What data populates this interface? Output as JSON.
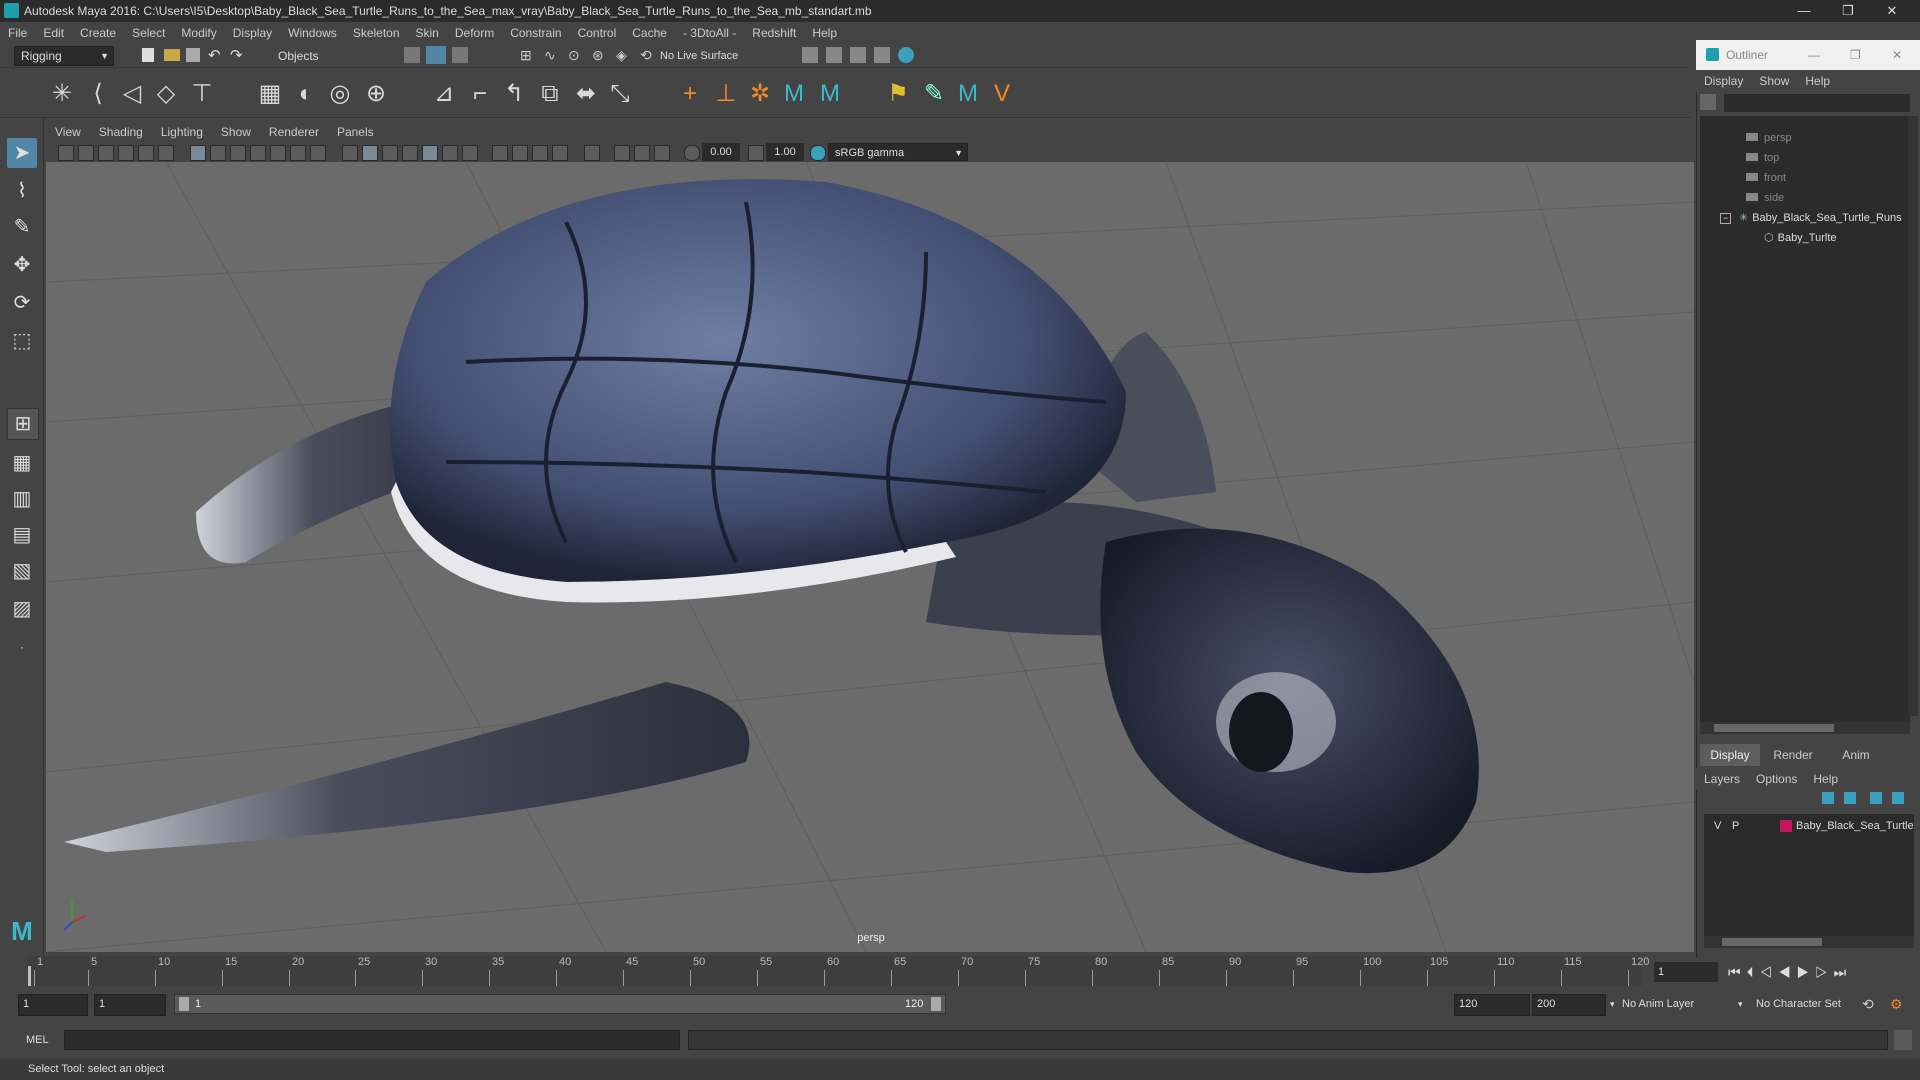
{
  "window": {
    "title": "Autodesk Maya 2016: C:\\Users\\I5\\Desktop\\Baby_Black_Sea_Turtle_Runs_to_the_Sea_max_vray\\Baby_Black_Sea_Turtle_Runs_to_the_Sea_mb_standart.mb",
    "minimize": "—",
    "restore": "❐",
    "close": "✕"
  },
  "menu": [
    "File",
    "Edit",
    "Create",
    "Select",
    "Modify",
    "Display",
    "Windows",
    "Skeleton",
    "Skin",
    "Deform",
    "Constrain",
    "Control",
    "Cache",
    "- 3DtoAll -",
    "Redshift",
    "Help"
  ],
  "toolbar": {
    "menuset": "Rigging",
    "selection_mode": "Objects",
    "live_surface": "No Live Surface"
  },
  "viewport": {
    "menu": [
      "View",
      "Shading",
      "Lighting",
      "Show",
      "Renderer",
      "Panels"
    ],
    "exposure": "0.00",
    "gamma": "1.00",
    "color_space": "sRGB gamma",
    "camera_label": "persp"
  },
  "outliner": {
    "title": "Outliner",
    "menu": [
      "Display",
      "Show",
      "Help"
    ],
    "items": [
      {
        "label": "persp",
        "type": "camera"
      },
      {
        "label": "top",
        "type": "camera"
      },
      {
        "label": "front",
        "type": "camera"
      },
      {
        "label": "side",
        "type": "camera"
      },
      {
        "label": "Baby_Black_Sea_Turtle_Runs",
        "type": "group"
      },
      {
        "label": "Baby_Turlte",
        "type": "mesh"
      }
    ]
  },
  "layer_editor": {
    "tabs": [
      "Display",
      "Render",
      "Anim"
    ],
    "active_tab": "Display",
    "menu": [
      "Layers",
      "Options",
      "Help"
    ],
    "layer": {
      "visible": "V",
      "playback": "P",
      "name": "Baby_Black_Sea_Turtle",
      "color": "#c2185b"
    }
  },
  "timeline": {
    "ticks": [
      "1",
      "5",
      "10",
      "15",
      "20",
      "25",
      "30",
      "35",
      "40",
      "45",
      "50",
      "55",
      "60",
      "65",
      "70",
      "75",
      "80",
      "85",
      "90",
      "95",
      "100",
      "105",
      "110",
      "115",
      "120"
    ],
    "current_frame": "1"
  },
  "range": {
    "start": "1",
    "playback_start": "1",
    "slider_start": "1",
    "slider_end": "120",
    "playback_end": "120",
    "end": "200",
    "anim_layer": "No Anim Layer",
    "character_set": "No Character Set"
  },
  "command_line": {
    "label": "MEL"
  },
  "status": {
    "help": "Select Tool: select an object"
  },
  "colors": {
    "accent": "#1e9fb0",
    "active_tool": "#5285a6",
    "viewport_bg": "#6b6b6b"
  }
}
